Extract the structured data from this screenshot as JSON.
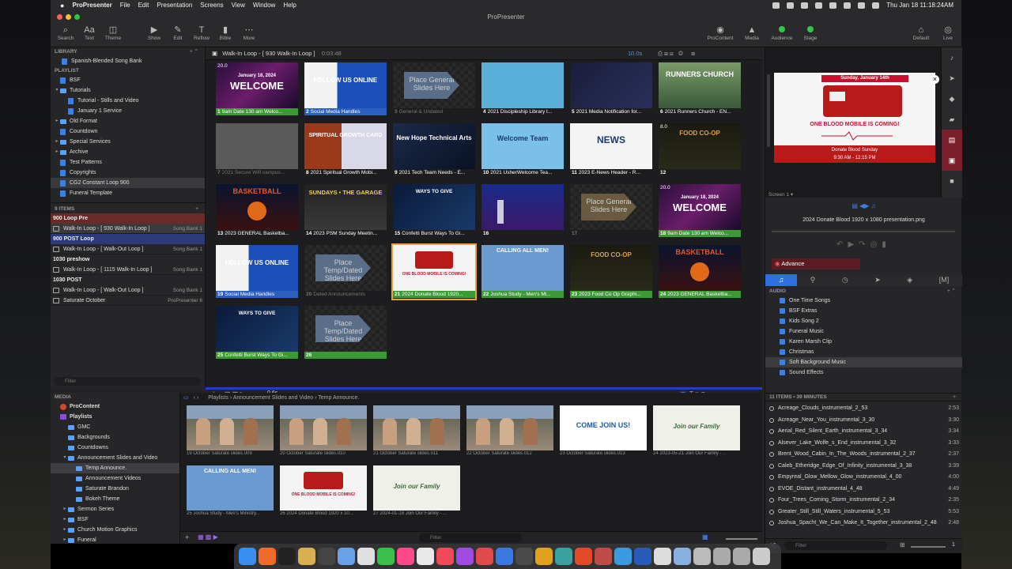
{
  "menubar": {
    "app_name": "ProPresenter",
    "menus": [
      "File",
      "Edit",
      "Presentation",
      "Screens",
      "View",
      "Window",
      "Help"
    ],
    "clock": "Thu Jan 18  11:18:24AM"
  },
  "window_title": "ProPresenter",
  "toolbar": {
    "left": [
      {
        "label": "Search",
        "icon": "search-icon",
        "glyph": "⌕"
      },
      {
        "label": "Text",
        "icon": "text-icon",
        "glyph": "Aa"
      },
      {
        "label": "Theme",
        "icon": "theme-icon",
        "glyph": "◫"
      },
      {
        "label": "Show",
        "icon": "play-icon",
        "glyph": "▶"
      },
      {
        "label": "Edit",
        "icon": "pencil-icon",
        "glyph": "✎"
      },
      {
        "label": "Reflow",
        "icon": "reflow-icon",
        "glyph": "T"
      },
      {
        "label": "Bible",
        "icon": "bible-icon",
        "glyph": "▮"
      },
      {
        "label": "More",
        "icon": "more-icon",
        "glyph": "⋯"
      }
    ],
    "right": [
      {
        "label": "ProContent",
        "icon": "procontent-icon",
        "glyph": "◉"
      },
      {
        "label": "Media",
        "icon": "media-icon",
        "glyph": "▲"
      },
      {
        "label": "Audience",
        "icon": "audience-dot",
        "glyph": ""
      },
      {
        "label": "Stage",
        "icon": "stage-dot",
        "glyph": ""
      },
      {
        "label": "Default",
        "icon": "default-icon",
        "glyph": "⌂"
      },
      {
        "label": "Live",
        "icon": "live-icon",
        "glyph": "◎"
      }
    ]
  },
  "library": {
    "library_header": "LIBRARY",
    "library_item": "Spanish-Blended Song Bank",
    "playlist_header": "PLAYLIST",
    "playlists": [
      {
        "label": "BSF",
        "kind": "doc",
        "indent": 0,
        "arrow": ""
      },
      {
        "label": "Tutorials",
        "kind": "folder",
        "indent": 0,
        "arrow": "▾"
      },
      {
        "label": "Tutorial - Stills and Video",
        "kind": "doc",
        "indent": 1,
        "arrow": ""
      },
      {
        "label": "January 1 Service",
        "kind": "doc",
        "indent": 1,
        "arrow": ""
      },
      {
        "label": "Old Format",
        "kind": "folder",
        "indent": 0,
        "arrow": "▸"
      },
      {
        "label": "Countdown",
        "kind": "doc",
        "indent": 0,
        "arrow": ""
      },
      {
        "label": "Special Services",
        "kind": "folder",
        "indent": 0,
        "arrow": "▸"
      },
      {
        "label": "Archive",
        "kind": "folder",
        "indent": 0,
        "arrow": "▸"
      },
      {
        "label": "Test Patterns",
        "kind": "doc",
        "indent": 0,
        "arrow": ""
      },
      {
        "label": "Copyrights",
        "kind": "doc",
        "indent": 0,
        "arrow": ""
      },
      {
        "label": "CG2 Constant Loop 900",
        "kind": "doc",
        "indent": 0,
        "arrow": "",
        "selected": true
      },
      {
        "label": "Funeral Template",
        "kind": "doc",
        "indent": 0,
        "arrow": ""
      }
    ],
    "items_count": "9 ITEMS",
    "items": [
      {
        "type": "header",
        "label": "900 Loop Pre",
        "color": "#6b2a2a"
      },
      {
        "type": "item",
        "label": "Walk-In Loop - [ 930 Walk-In Loop ]",
        "source": "Song Bank 1",
        "selected": true
      },
      {
        "type": "header",
        "label": "900 POST Loop",
        "color": "#2c3a7a"
      },
      {
        "type": "item",
        "label": "Walk-In Loop - [ Walk-Out Loop ]",
        "source": "Song Bank 1"
      },
      {
        "type": "header",
        "label": "1030 preshow",
        "color": ""
      },
      {
        "type": "item",
        "label": "Walk-In Loop - [ 1115 Walk-In Loop ]",
        "source": "Song Bank 1"
      },
      {
        "type": "header",
        "label": "1030 POST",
        "color": ""
      },
      {
        "type": "item",
        "label": "Walk-In Loop - [ Walk-Out Loop ]",
        "source": "Song Bank 1"
      },
      {
        "type": "item",
        "label": "Saturate October",
        "source": "ProPresenter 6"
      }
    ],
    "filter_placeholder": "Filter"
  },
  "slides_header": {
    "title": "Walk-In Loop - [ 930 Walk-In Loop ]",
    "duration": "0:03:48",
    "timer": "10.0s"
  },
  "slides": [
    {
      "n": "1",
      "caption": "9am Date 130 am Welco...",
      "cap": "green",
      "theme": "welcome",
      "tag": "20.0"
    },
    {
      "n": "2",
      "caption": "Social Media Handles",
      "cap": "blue",
      "theme": "social"
    },
    {
      "n": "3",
      "caption": "General & Undated",
      "cap": "gray",
      "theme": "placeholder",
      "ph": "Place General Slides Here"
    },
    {
      "n": "4",
      "caption": "2021 Discipleship Library t...",
      "cap": "",
      "theme": "library"
    },
    {
      "n": "5",
      "caption": "2021 Media Notification for...",
      "cap": "",
      "theme": "dark-media"
    },
    {
      "n": "6",
      "caption": "2021 Runners Church - EN...",
      "cap": "",
      "theme": "runners"
    },
    {
      "n": "7",
      "caption": "2021 Secure Wifi campus...",
      "cap": "gray",
      "theme": "wifi"
    },
    {
      "n": "8",
      "caption": "2021 Spiritual Growth Mobi...",
      "cap": "",
      "theme": "spiritual"
    },
    {
      "n": "9",
      "caption": "2021 Tech Team Needs - E...",
      "cap": "",
      "theme": "tech"
    },
    {
      "n": "10",
      "caption": "2021 UsherWelcome Tea...",
      "cap": "",
      "theme": "usher"
    },
    {
      "n": "11",
      "caption": "2023 E-News Header - R...",
      "cap": "",
      "theme": "enews"
    },
    {
      "n": "12",
      "caption": "",
      "cap": "",
      "theme": "food",
      "tag": "8.0"
    },
    {
      "n": "13",
      "caption": "2023 GENERAL Basketba...",
      "cap": "",
      "theme": "basketball"
    },
    {
      "n": "14",
      "caption": "2023 PSM Sunday Meetin...",
      "cap": "",
      "theme": "psm"
    },
    {
      "n": "15",
      "caption": "Confetti Burst Ways To Gi...",
      "cap": "",
      "theme": "give"
    },
    {
      "n": "16",
      "caption": "",
      "cap": "",
      "theme": "worship"
    },
    {
      "n": "17",
      "caption": "",
      "cap": "gray",
      "theme": "placeholder2",
      "ph": "Place General Slides Here"
    },
    {
      "n": "18",
      "caption": "9am Date 130 am Welco...",
      "cap": "green",
      "theme": "welcome",
      "tag": "20.0"
    },
    {
      "n": "19",
      "caption": "Social Media Handles",
      "cap": "blue",
      "theme": "social"
    },
    {
      "n": "20",
      "caption": "Dated Announcements",
      "cap": "gray",
      "theme": "placeholder",
      "ph": "Place Temp/Dated Slides Here"
    },
    {
      "n": "21",
      "caption": "2024 Donate Blood 1920...",
      "cap": "green",
      "theme": "blood",
      "selected": true
    },
    {
      "n": "22",
      "caption": "Joshua Study - Men's Mi...",
      "cap": "green",
      "theme": "men"
    },
    {
      "n": "23",
      "caption": "2023 Food Co Op Graphi...",
      "cap": "green",
      "theme": "food"
    },
    {
      "n": "24",
      "caption": "2023 GENERAL Basketba...",
      "cap": "green",
      "theme": "basketball"
    },
    {
      "n": "25",
      "caption": "Confetti Burst Ways To Gi...",
      "cap": "green",
      "theme": "give"
    },
    {
      "n": "26",
      "caption": "",
      "cap": "green",
      "theme": "placeholder",
      "ph": "Place Temp/Dated Slides Here"
    }
  ],
  "slides_footer": {
    "time": "0.6s"
  },
  "slide_text": {
    "welcome_date": "January 18, 2024",
    "welcome": "WELCOME",
    "follow": "FOLLOW US ONLINE",
    "runners": "RUNNERS CHURCH",
    "usher": "Welcome Team",
    "news": "NEWS",
    "food": "FOOD CO-OP",
    "basketball": "BASKETBALL",
    "psm": "SUNDAYS • THE GARAGE",
    "give": "WAYS TO GIVE",
    "blood_title": "ONE BLOOD MOBILE IS COMING!",
    "men": "CALLING ALL MEN!",
    "spiritual": "SPIRITUAL GROWTH CARD",
    "tech": "New Hope Technical Arts"
  },
  "preview": {
    "date_banner": "Sunday, January 14th",
    "headline": "ONE BLOOD MOBILE IS COMING!",
    "footer_banner": "Donate Blood Sunday",
    "footer_time": "9:30 AM - 12:15 PM",
    "screen": "Screen 1 ▾",
    "file": "2024 Donate Blood 1920 x 1080 presentation.png",
    "advance": "Advance"
  },
  "audio": {
    "header": "AUDIO",
    "playlists": [
      {
        "label": "One Time Songs"
      },
      {
        "label": "BSF Extras"
      },
      {
        "label": "Kids Song 2"
      },
      {
        "label": "Funeral Music"
      },
      {
        "label": "Karen Marsh Clip"
      },
      {
        "label": "Christmas"
      },
      {
        "label": "Soft Background Music",
        "selected": true
      },
      {
        "label": "Sound Effects"
      }
    ],
    "count": "11 ITEMS • 39 MINUTES",
    "tracks": [
      {
        "name": "Acreage_Clouds_instrumental_2_53",
        "dur": "2:53"
      },
      {
        "name": "Acreage_Near_You_instrumental_3_30",
        "dur": "3:30"
      },
      {
        "name": "Aerial_Red_Silent_Earth_instrumental_3_34",
        "dur": "3:34"
      },
      {
        "name": "Alsever_Lake_Wolfe_s_End_instrumental_3_32",
        "dur": "3:33"
      },
      {
        "name": "Brent_Wood_Cabin_In_The_Woods_instrumental_2_37",
        "dur": "2:37"
      },
      {
        "name": "Caleb_Etheridge_Edge_Of_Infinity_instrumental_3_38",
        "dur": "3:39"
      },
      {
        "name": "Empyreal_Glow_Mellow_Glow_instrumental_4_00",
        "dur": "4:00"
      },
      {
        "name": "EVOE_Distant_instrumental_4_48",
        "dur": "4:49"
      },
      {
        "name": "Four_Trees_Coming_Storm_instrumental_2_34",
        "dur": "2:35"
      },
      {
        "name": "Greater_Still_Still_Waters_instrumental_5_53",
        "dur": "5:53"
      },
      {
        "name": "Joshua_Spacht_We_Can_Make_It_Together_instrumental_2_48",
        "dur": "2:48"
      }
    ],
    "filter_placeholder": "Filter",
    "volume_value": "1"
  },
  "media": {
    "header": "MEDIA",
    "tree": [
      {
        "label": "ProContent",
        "bold": true,
        "indent": 0,
        "icon": "procontent"
      },
      {
        "label": "Playlists",
        "bold": true,
        "indent": 0,
        "icon": "playlists"
      },
      {
        "label": "GMC",
        "indent": 1
      },
      {
        "label": "Backgrounds",
        "indent": 1
      },
      {
        "label": "Countdowns",
        "indent": 1
      },
      {
        "label": "Announcement Slides and Video",
        "indent": 1,
        "arrow": "▾"
      },
      {
        "label": "Temp Announce.",
        "indent": 2,
        "selected": true
      },
      {
        "label": "Announcement Videos",
        "indent": 2
      },
      {
        "label": "Saturate Brandon",
        "indent": 2
      },
      {
        "label": "Bokeh Theme",
        "indent": 2
      },
      {
        "label": "Sermon Series",
        "indent": 1,
        "arrow": "▸"
      },
      {
        "label": "BSF",
        "indent": 1,
        "arrow": "▸"
      },
      {
        "label": "Church Motion Graphics",
        "indent": 1,
        "arrow": "▸"
      },
      {
        "label": "Funeral",
        "indent": 1,
        "arrow": "▸"
      }
    ],
    "breadcrumb": [
      "Playlists",
      "Announcement Slides and Video",
      "Temp Announce."
    ],
    "thumbs": [
      {
        "label": "19  October Saturate slides.009",
        "kind": "photo"
      },
      {
        "label": "20  October Saturate slides.010",
        "kind": "photo"
      },
      {
        "label": "21  October Saturate slides.011",
        "kind": "photo"
      },
      {
        "label": "22  October Saturate slides.012",
        "kind": "photo"
      },
      {
        "label": "23  October Saturate slides.013",
        "kind": "joinus"
      },
      {
        "label": "24  2023-05-21 Join Our Family - ...",
        "kind": "family"
      },
      {
        "label": "25  Joshua Study - Men's Ministry...",
        "kind": "men"
      },
      {
        "label": "26  2024 Donate Blood 1920 x 10...",
        "kind": "blood"
      },
      {
        "label": "27  2024-01-18 Join Our Family - ...",
        "kind": "family"
      }
    ],
    "join_us": "COME JOIN US!",
    "family": "Join our Family",
    "filter_placeholder": "Filter"
  },
  "colors": {
    "accent": "#2f6fe0",
    "green_cap": "#3c9a35",
    "blue_cap": "#2c5fbf",
    "live_green": "#2ec84a",
    "selection": "#e8a13c"
  }
}
